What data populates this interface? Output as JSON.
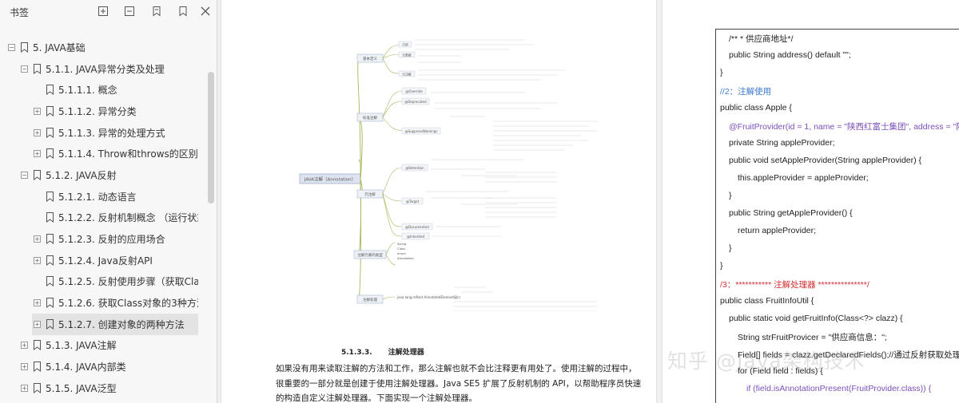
{
  "sidebar": {
    "title": "书签",
    "tools": [
      {
        "name": "expand-all-icon"
      },
      {
        "name": "collapse-all-icon"
      },
      {
        "name": "bookmark-add-icon"
      },
      {
        "name": "bookmark-icon"
      },
      {
        "name": "close-icon"
      }
    ],
    "items": [
      {
        "label": "5. JAVA基础",
        "expander": "minus",
        "selected": false
      },
      {
        "label": "5.1.1. JAVA异常分类及处理",
        "expander": "minus",
        "selected": false
      },
      {
        "label": "5.1.1.1. 概念",
        "expander": "none",
        "selected": false
      },
      {
        "label": "5.1.1.2. 异常分类",
        "expander": "plus",
        "selected": false
      },
      {
        "label": "5.1.1.3. 异常的处理方式",
        "expander": "plus",
        "selected": false
      },
      {
        "label": "5.1.1.4. Throw和throws的区别：",
        "expander": "plus",
        "selected": false
      },
      {
        "label": "5.1.2. JAVA反射",
        "expander": "minus",
        "selected": false
      },
      {
        "label": "5.1.2.1. 动态语言",
        "expander": "none",
        "selected": false
      },
      {
        "label": "5.1.2.2. 反射机制概念  （运行状态中",
        "expander": "none",
        "selected": false
      },
      {
        "label": "5.1.2.3. 反射的应用场合",
        "expander": "plus",
        "selected": false
      },
      {
        "label": "5.1.2.4. Java反射API",
        "expander": "plus",
        "selected": false
      },
      {
        "label": "5.1.2.5. 反射使用步骤（获取Class对",
        "expander": "none",
        "selected": false
      },
      {
        "label": "5.1.2.6. 获取Class对象的3种方法",
        "expander": "plus",
        "selected": false
      },
      {
        "label": "5.1.2.7. 创建对象的两种方法",
        "expander": "plus",
        "selected": true
      },
      {
        "label": "5.1.3. JAVA注解",
        "expander": "plus",
        "selected": false
      },
      {
        "label": "5.1.4. JAVA内部类",
        "expander": "plus",
        "selected": false
      },
      {
        "label": "5.1.5. JAVA泛型",
        "expander": "plus",
        "selected": false
      }
    ]
  },
  "page1": {
    "mindmap": {
      "center": "JAVA注解（Annotation）",
      "branches": [
        {
          "label": "基本定义",
          "children": [
            "已用",
            "元数据",
            "元注解"
          ]
        },
        {
          "label": "标准注解",
          "children": [
            "@Override",
            "@Deprecated",
            "@SuppressWarnings"
          ]
        },
        {
          "label": "元注解",
          "children": [
            "@Retention",
            "@Target",
            "@Documented",
            "@Inherited"
          ]
        },
        {
          "label": "注解元素的类型",
          "children": [
            "String",
            "Class",
            "enum",
            "Annotation"
          ]
        },
        {
          "label": "注解处理",
          "children": [
            "java.lang.reflect.AnnotatedElement接口"
          ]
        }
      ]
    },
    "section_number": "5.1.3.3.",
    "section_title": "注解处理器",
    "paragraph_lines": [
      "如果没有用来读取注解的方法和工作，那么注解也就不会比注释更有用处了。使用注解的过程中，",
      "很重要的一部分就是创建于使用注解处理器。Java SE5 扩展了反射机制的 API，以帮助程序员快速",
      "的构造自定义注解处理器。下面实现一个注解处理器。"
    ]
  },
  "page2": {
    "code_lines": [
      {
        "text": "/** * 供应商地址*/",
        "kind": "normal",
        "indent": 1
      },
      {
        "text": "public String address() default \"\";",
        "kind": "normal",
        "indent": 1
      },
      {
        "text": "}",
        "kind": "normal",
        "indent": 0
      },
      {
        "text": "//2：注解使用",
        "kind": "comment",
        "indent": 0
      },
      {
        "text": "public class Apple {",
        "kind": "normal",
        "indent": 0
      },
      {
        "text": "@FruitProvider(id = 1, name = \"陕西红富士集团\", address = \"陕西",
        "kind": "anno",
        "indent": 1
      },
      {
        "text": "private String appleProvider;",
        "kind": "normal",
        "indent": 1
      },
      {
        "text": "public void setAppleProvider(String appleProvider) {",
        "kind": "normal",
        "indent": 1
      },
      {
        "text": "this.appleProvider = appleProvider;",
        "kind": "normal",
        "indent": 2
      },
      {
        "text": "}",
        "kind": "normal",
        "indent": 1
      },
      {
        "text": "public String getAppleProvider() {",
        "kind": "normal",
        "indent": 1
      },
      {
        "text": "return appleProvider;",
        "kind": "normal",
        "indent": 2
      },
      {
        "text": "}",
        "kind": "normal",
        "indent": 1
      },
      {
        "text": "}",
        "kind": "normal",
        "indent": 0
      },
      {
        "text": "/3：*********** 注解处理器 ***************/",
        "kind": "red",
        "indent": 0
      },
      {
        "text": "public class FruitInfoUtil {",
        "kind": "normal",
        "indent": 0
      },
      {
        "text": "public static void getFruitInfo(Class<?> clazz) {",
        "kind": "normal",
        "indent": 1
      },
      {
        "text": "String strFruitProvicer = \"供应商信息：\";",
        "kind": "normal",
        "indent": 2
      },
      {
        "text": "Field[] fields = clazz.getDeclaredFields();//通过反射获取处理注",
        "kind": "normal",
        "indent": 2
      },
      {
        "text": "for (Field field : fields) {",
        "kind": "normal",
        "indent": 2
      },
      {
        "text": "if (field.isAnnotationPresent(FruitProvider.class)) {",
        "kind": "anno",
        "indent": 3
      }
    ]
  },
  "watermark": "知乎 @Java架构技术",
  "colors": {
    "sidebar_bg": "#f7f7f7",
    "selected_bg": "#e3e3e3",
    "comment": "#3d7ad1",
    "red": "#d23030",
    "annotation": "#7a4fb8",
    "mindmap_line": "#a3b85a"
  }
}
